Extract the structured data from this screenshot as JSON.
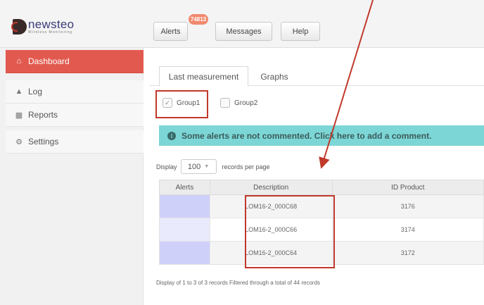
{
  "logo": {
    "name": "newsteo",
    "tagline": "Wireless Monitoring"
  },
  "header": {
    "buttons": [
      {
        "label": "Alerts"
      },
      {
        "label": "Messages"
      },
      {
        "label": "Help"
      }
    ],
    "alerts_badge": "74813"
  },
  "sidebar": {
    "items": [
      {
        "label": "Dashboard",
        "icon": "home-icon",
        "active": true
      },
      {
        "label": "Log",
        "icon": "pin-icon"
      },
      {
        "label": "Reports",
        "icon": "printer-icon"
      },
      {
        "label": "Settings",
        "icon": "gears-icon"
      }
    ]
  },
  "tabs": [
    {
      "label": "Last measurement",
      "active": true
    },
    {
      "label": "Graphs"
    }
  ],
  "groups": [
    {
      "label": "Group1",
      "checked": true
    },
    {
      "label": "Group2",
      "checked": false
    }
  ],
  "alert_banner": {
    "text": "Some alerts are not commented. Click here to add a comment."
  },
  "display": {
    "prefix": "Display",
    "value": "100",
    "suffix": "records per page"
  },
  "table": {
    "headers": [
      "Alerts",
      "Description",
      "ID Product"
    ],
    "rows": [
      {
        "alerts": "",
        "description": "LOM16-2_000C68",
        "id_product": "3176"
      },
      {
        "alerts": "",
        "description": "LOM16-2_000C66",
        "id_product": "3174"
      },
      {
        "alerts": "",
        "description": "LOM16-2_000C64",
        "id_product": "3172"
      }
    ]
  },
  "footer": {
    "info": "Display of 1 to 3 of 3 records Filtered through a total of 44 records"
  },
  "colors": {
    "accent": "#e25a4f",
    "annotation": "#c0392b",
    "alert_banner": "#7dd6d6",
    "alert_cell": "#cfd0fa"
  }
}
